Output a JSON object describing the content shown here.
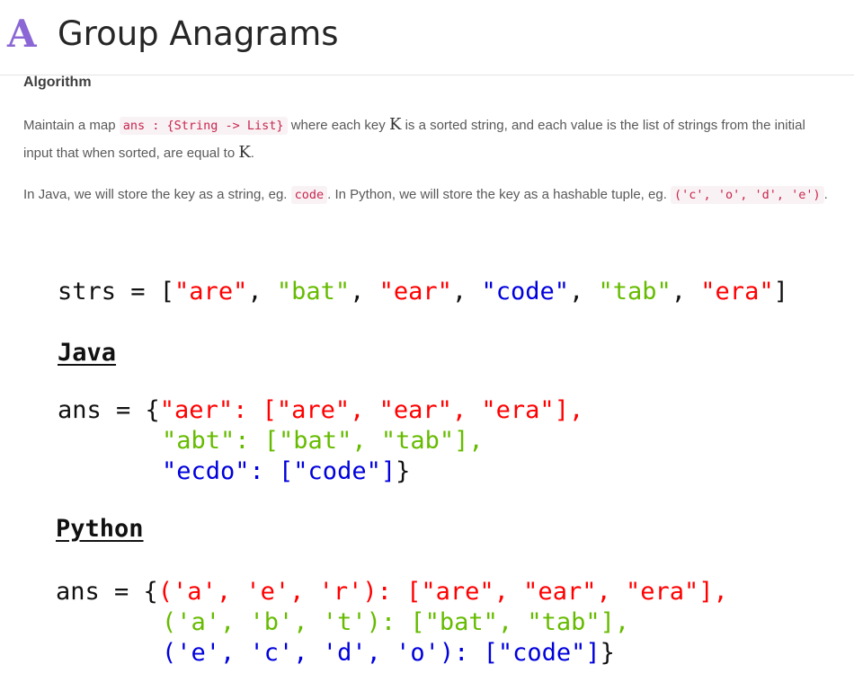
{
  "header": {
    "logo_letter": "A",
    "title": "Group Anagrams"
  },
  "section": {
    "heading": "Algorithm"
  },
  "para1": {
    "t1": "Maintain a map ",
    "code1": "ans : {String -> List}",
    "t2": " where each key ",
    "m1": "K",
    "t3": " is a sorted string, and each value is the list of strings from the initial input that when sorted, are equal to ",
    "m2": "K",
    "t4": "."
  },
  "para2": {
    "t1": "In Java, we will store the key as a string, eg. ",
    "code1": "code",
    "t2": ". In Python, we will store the key as a hashable tuple, eg. ",
    "code2": "('c', 'o', 'd', 'e')",
    "t3": "."
  },
  "figure": {
    "strs_line": {
      "prefix": "strs = [",
      "s1": "\"are\"",
      "c1": ", ",
      "s2": "\"bat\"",
      "c2": ", ",
      "s3": "\"ear\"",
      "c3": ", ",
      "s4": "\"code\"",
      "c4": ", ",
      "s5": "\"tab\"",
      "c5": ", ",
      "s6": "\"era\"",
      "suffix": "]"
    },
    "java_label": "Java",
    "java": {
      "prefix": "ans = {",
      "l1": "\"aer\": [\"are\", \"ear\", \"era\"],",
      "l2": "\"abt\": [\"bat\", \"tab\"],",
      "l3": "\"ecdo\": [\"code\"]",
      "close": "}"
    },
    "python_label": "Python",
    "python": {
      "prefix": "ans = {",
      "l1": "('a', 'e', 'r'): [\"are\", \"ear\", \"era\"],",
      "l2": "('a', 'b', 't'): [\"bat\", \"tab\"],",
      "l3": "('e', 'c', 'd', 'o'): [\"code\"]",
      "close": "}"
    },
    "colors": {
      "group1": "#ff0000",
      "group2": "#66bb00",
      "group3": "#0000dd"
    }
  }
}
